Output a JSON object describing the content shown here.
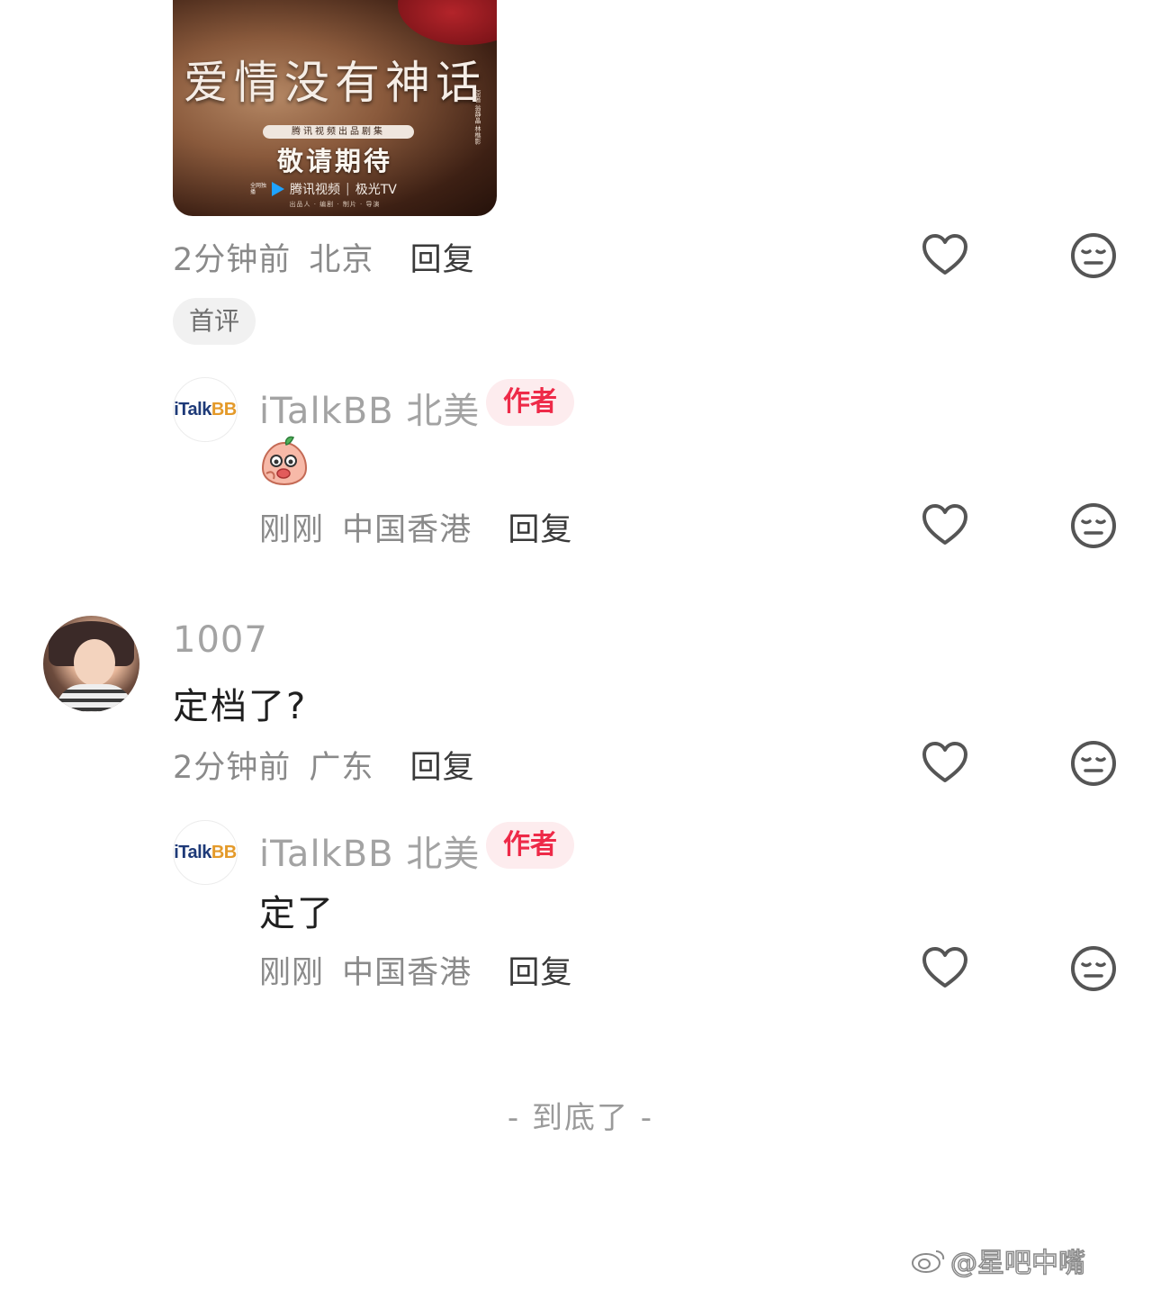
{
  "poster": {
    "title": "爱情没有神话",
    "side_note": "原著 翁静晶 林樵影",
    "pill": "腾讯视频出品剧集",
    "await": "敬请期待",
    "brand_small": "全网独播",
    "brand_1": "腾讯视频",
    "brand_sep": "|",
    "brand_2": "极光TV",
    "credits": "出品人 · 编剧 · 制片 · 导演"
  },
  "comment1": {
    "time": "2分钟前",
    "location": "北京",
    "reply": "回复",
    "tag": "首评"
  },
  "reply1": {
    "author": "iTalkBB 北美",
    "badge": "作者",
    "avatar_text_i": "iTalk",
    "avatar_text_bb": "BB",
    "time": "刚刚",
    "location": "中国香港",
    "reply": "回复",
    "emoji": "peach-sticker"
  },
  "comment2": {
    "username": "1007",
    "text": "定档了?",
    "time": "2分钟前",
    "location": "广东",
    "reply": "回复"
  },
  "reply2": {
    "author": "iTalkBB 北美",
    "badge": "作者",
    "avatar_text_i": "iTalk",
    "avatar_text_bb": "BB",
    "text": "定了",
    "time": "刚刚",
    "location": "中国香港",
    "reply": "回复"
  },
  "footer": {
    "end_text": "- 到底了 -",
    "watermark": "@星吧中嘴"
  },
  "colors": {
    "author_badge_bg": "#fdecee",
    "author_badge_text": "#ee2a48",
    "meta_text": "#8a8a8a",
    "icon_stroke": "#555555"
  }
}
